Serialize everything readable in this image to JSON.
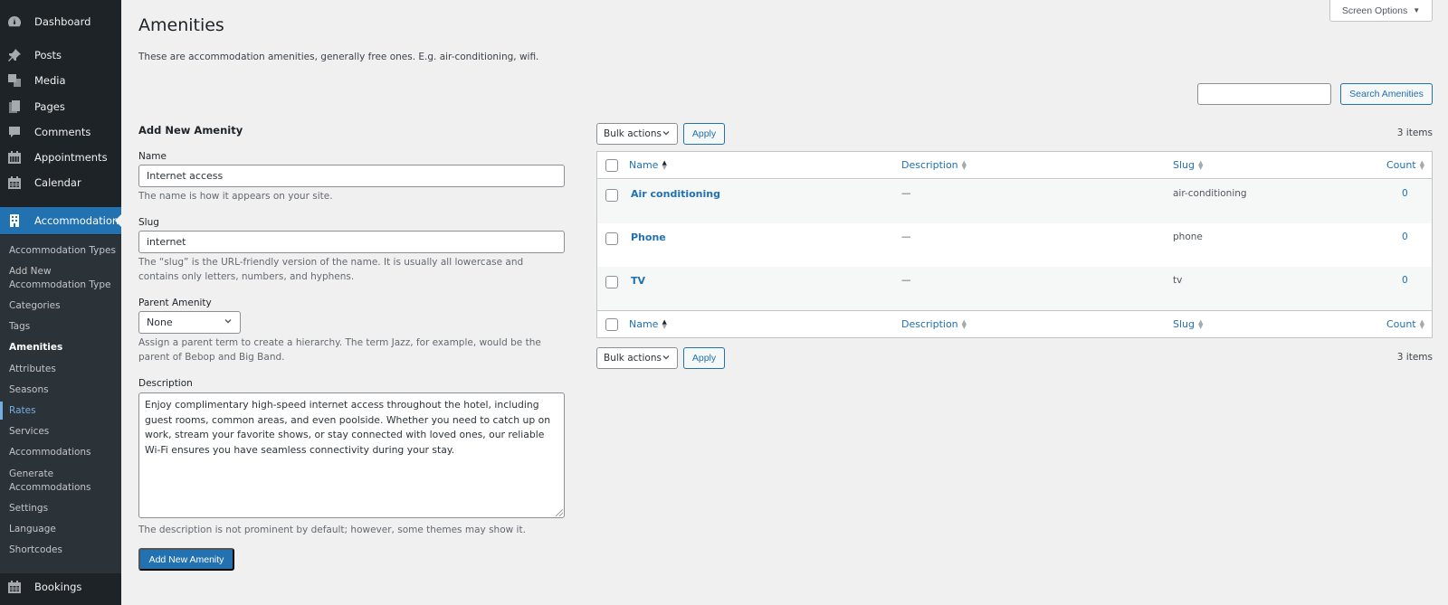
{
  "sidebar": {
    "top_items": [
      {
        "label": "Dashboard",
        "icon": "dashboard-icon"
      },
      {
        "label": "Posts",
        "icon": "pushpin-icon"
      },
      {
        "label": "Media",
        "icon": "media-icon"
      },
      {
        "label": "Pages",
        "icon": "pages-icon"
      },
      {
        "label": "Comments",
        "icon": "comment-icon"
      },
      {
        "label": "Appointments",
        "icon": "calendar-icon"
      },
      {
        "label": "Calendar",
        "icon": "calendar-icon"
      },
      {
        "label": "Accommodation",
        "icon": "building-icon",
        "active": true
      }
    ],
    "submenu": [
      "Accommodation Types",
      "Add New Accommodation Type",
      "Categories",
      "Tags",
      "Amenities",
      "Attributes",
      "Seasons",
      "Rates",
      "Services",
      "Accommodations",
      "Generate Accommodations",
      "Settings",
      "Language",
      "Shortcodes"
    ],
    "submenu_wrapped": {
      "add_new_1": "Add New",
      "add_new_2": "Accommodation Type",
      "generate_1": "Generate",
      "generate_2": "Accommodations"
    },
    "current_submenu": "Amenities",
    "hover_submenu": "Rates",
    "bottom_item": {
      "label": "Bookings",
      "icon": "calendar-icon"
    }
  },
  "header": {
    "title": "Amenities",
    "description": "These are accommodation amenities, generally free ones. E.g. air-conditioning, wifi.",
    "screen_options": "Screen Options"
  },
  "search": {
    "value": "",
    "placeholder": "",
    "button": "Search Amenities"
  },
  "form": {
    "title": "Add New Amenity",
    "name_label": "Name",
    "name_value": "Internet access",
    "name_help": "The name is how it appears on your site.",
    "slug_label": "Slug",
    "slug_value": "internet",
    "slug_help": "The “slug” is the URL-friendly version of the name. It is usually all lowercase and contains only letters, numbers, and hyphens.",
    "parent_label": "Parent Amenity",
    "parent_value": "None",
    "parent_help": "Assign a parent term to create a hierarchy. The term Jazz, for example, would be the parent of Bebop and Big Band.",
    "description_label": "Description",
    "description_value": "Enjoy complimentary high-speed internet access throughout the hotel, including guest rooms, common areas, and even poolside. Whether you need to catch up on work, stream your favorite shows, or stay connected with loved ones, our reliable Wi-Fi ensures you have seamless connectivity during your stay.",
    "description_help": "The description is not prominent by default; however, some themes may show it.",
    "submit": "Add New Amenity"
  },
  "table": {
    "bulk_actions": "Bulk actions",
    "apply": "Apply",
    "items_count": "3 items",
    "columns": [
      "Name",
      "Description",
      "Slug",
      "Count"
    ],
    "rows": [
      {
        "name": "Air conditioning",
        "description": "—",
        "slug": "air-conditioning",
        "count": "0"
      },
      {
        "name": "Phone",
        "description": "—",
        "slug": "phone",
        "count": "0"
      },
      {
        "name": "TV",
        "description": "—",
        "slug": "tv",
        "count": "0"
      }
    ]
  },
  "colors": {
    "accent": "#2271b1",
    "sidebar_bg": "#1d2327",
    "submenu_bg": "#2c3338",
    "page_bg": "#f0f0f1"
  }
}
